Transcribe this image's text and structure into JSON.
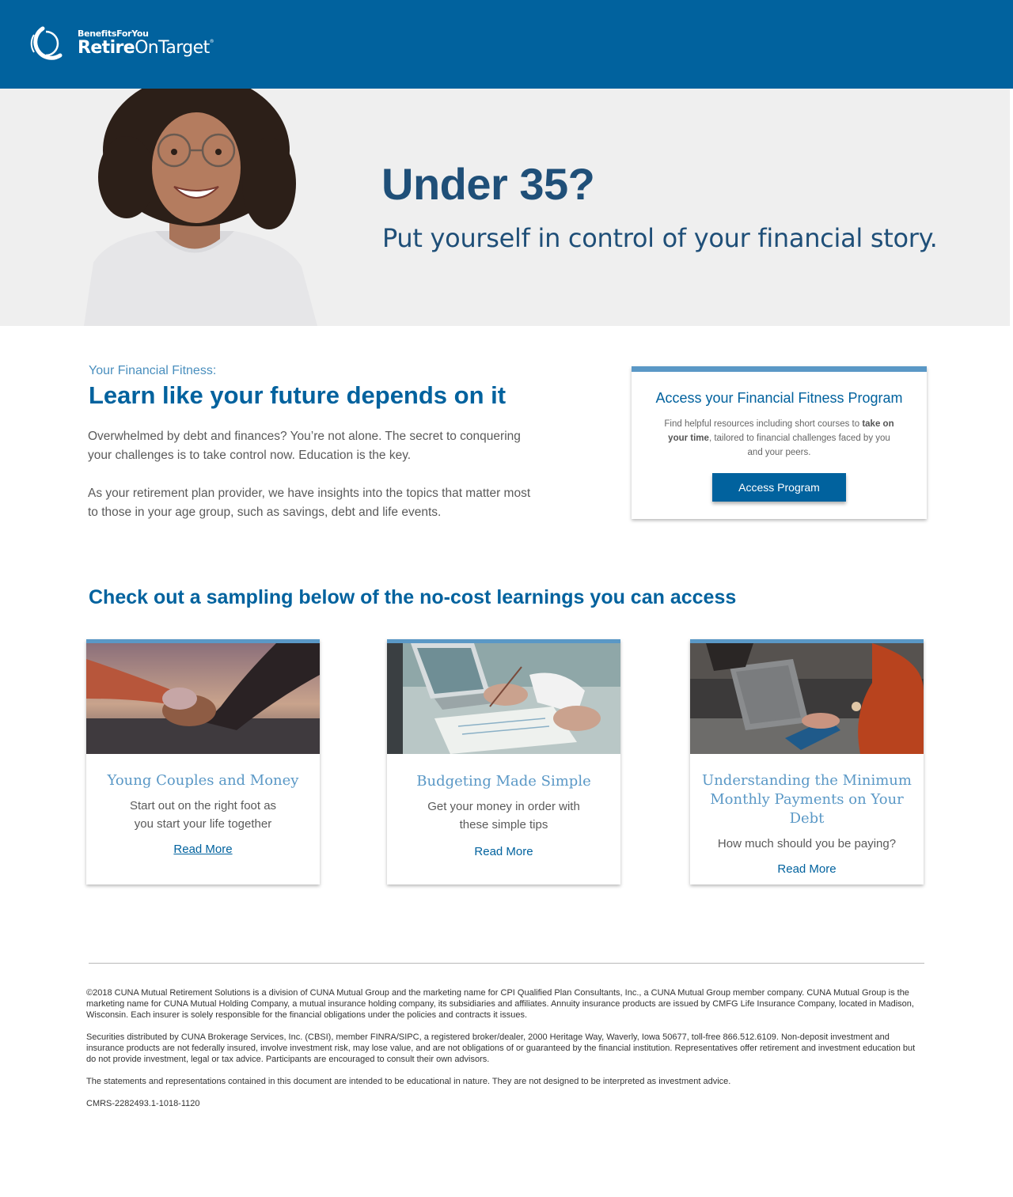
{
  "header": {
    "brand_small_prefix": "BenefitsFor",
    "brand_small_suffix": "You",
    "brand_big_bold": "Retire",
    "brand_big_regular": "OnTarget",
    "brand_mark": "®",
    "background_color": "#01629e"
  },
  "hero": {
    "title": "Under 35?",
    "subtitle": "Put yourself in control of your financial story.",
    "photo_icon": "smiling-woman-portrait"
  },
  "intro": {
    "eyebrow": "Your Financial Fitness:",
    "heading": "Learn like your future depends on it",
    "paragraph_1": "Overwhelmed by debt and finances? You’re not alone. The secret to conquering your challenges is to take control now. Education is the key.",
    "paragraph_2": "As your retirement plan provider, we have insights into the topics that matter most to those in your age group, such as savings, debt and life events."
  },
  "program": {
    "title": "Access your Financial Fitness Program",
    "text_before": "Find helpful resources including short courses to ",
    "text_bold": "take on your time",
    "text_after": ", tailored to financial challenges faced by you and your peers.",
    "button_label": "Access Program"
  },
  "sampling": {
    "heading": "Check out a sampling below of the no-cost learnings you can access",
    "cards": [
      {
        "title": "Young Couples and Money",
        "description": "Start out on the right foot as you start your life together",
        "link": "Read More",
        "image_icon": "couple-holding-hands-photo"
      },
      {
        "title": "Budgeting Made Simple",
        "description": "Get your money in order with these simple tips",
        "link": "Read More",
        "image_icon": "budget-paperwork-laptop-photo"
      },
      {
        "title": "Understanding the Minimum Monthly Payments on Your Debt",
        "description": "How much should you be paying?",
        "link": "Read More",
        "image_icon": "tablet-payment-photo"
      }
    ]
  },
  "footer": {
    "legal_1": "©2018 CUNA Mutual Retirement Solutions is a division of CUNA Mutual Group and the marketing name for CPI Qualified Plan Consultants, Inc., a CUNA Mutual Group member company. CUNA Mutual Group is the marketing name for CUNA Mutual Holding Company, a mutual insurance holding company, its subsidiaries and affiliates. Annuity insurance products are issued by CMFG Life Insurance Company, located in Madison, Wisconsin. Each insurer is solely responsible for the financial obligations under the policies and contracts it issues.",
    "legal_2": "Securities distributed by CUNA Brokerage Services, Inc. (CBSI), member FINRA/SIPC, a registered broker/dealer, 2000 Heritage Way, Waverly, Iowa 50677, toll-free 866.512.6109. Non-deposit investment and insurance products are not federally insured, involve investment risk, may lose value, and are not obligations of or guaranteed by the financial institution. Representatives offer retirement and investment education but do not provide investment, legal or tax advice. Participants are encouraged to consult their own advisors.",
    "legal_3": "The statements and representations contained in this document are intended to be educational in nature. They are not designed to be interpreted as investment advice.",
    "code": "CMRS-2282493.1-1018-1120"
  },
  "colors": {
    "primary": "#01629e",
    "accent": "#5a98c6",
    "heading_dark": "#1f4f78",
    "hero_bg": "#efefef"
  }
}
